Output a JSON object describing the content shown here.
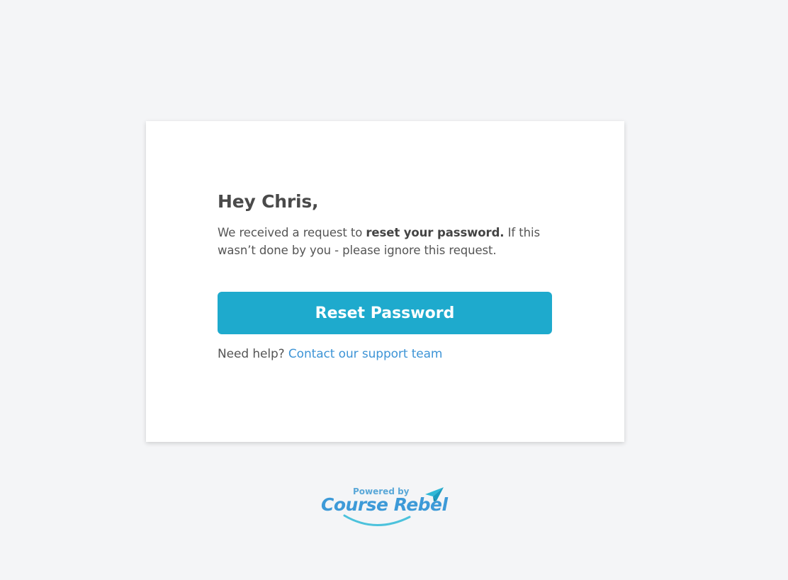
{
  "email": {
    "greeting": "Hey Chris,",
    "message_before": "We received a request to ",
    "message_bold": "reset your password.",
    "message_after": " If this wasn’t done by you - please ignore this request.",
    "button_label": "Reset Password",
    "help_text": "Need help? ",
    "help_link": "Contact our support team"
  },
  "footer": {
    "powered_by": "Powered by",
    "brand": "Course Rebel"
  },
  "colors": {
    "background": "#f4f5f7",
    "button": "#1eaacd",
    "link": "#3d94d6",
    "brand": "#3d9ad8"
  }
}
